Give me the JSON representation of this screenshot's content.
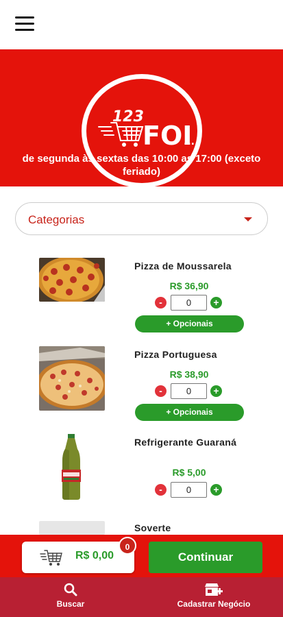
{
  "header": {
    "menu_icon": "hamburger-menu-icon",
    "brand": "123 FOI...",
    "hours": "de segunda às sextas das 10:00 as 17:00 (exceto feriado)"
  },
  "category_select": {
    "label": "Categorias",
    "icon": "caret-down-icon"
  },
  "products": [
    {
      "name": "Pizza de Moussarela",
      "price": "R$ 36,90",
      "qty": "0",
      "options_label": "+ Opcionais"
    },
    {
      "name": "Pizza Portuguesa",
      "price": "R$ 38,90",
      "qty": "0",
      "options_label": "+ Opcionais"
    },
    {
      "name": "Refrigerante Guaraná",
      "price": "R$ 5,00",
      "qty": "0"
    },
    {
      "name": "Soverte"
    }
  ],
  "qty_controls": {
    "minus": "-",
    "plus": "+"
  },
  "cart": {
    "total": "R$ 0,00",
    "count": "0",
    "continue_label": "Continuar"
  },
  "bottom_nav": [
    {
      "label": "Buscar",
      "icon": "search-icon"
    },
    {
      "label": "Cadastrar Negócio",
      "icon": "add-business-icon"
    }
  ],
  "colors": {
    "brand_red": "#e4130b",
    "nav_red": "#b82033",
    "accent_green": "#2a9b2a",
    "minus_red": "#e2323a"
  }
}
